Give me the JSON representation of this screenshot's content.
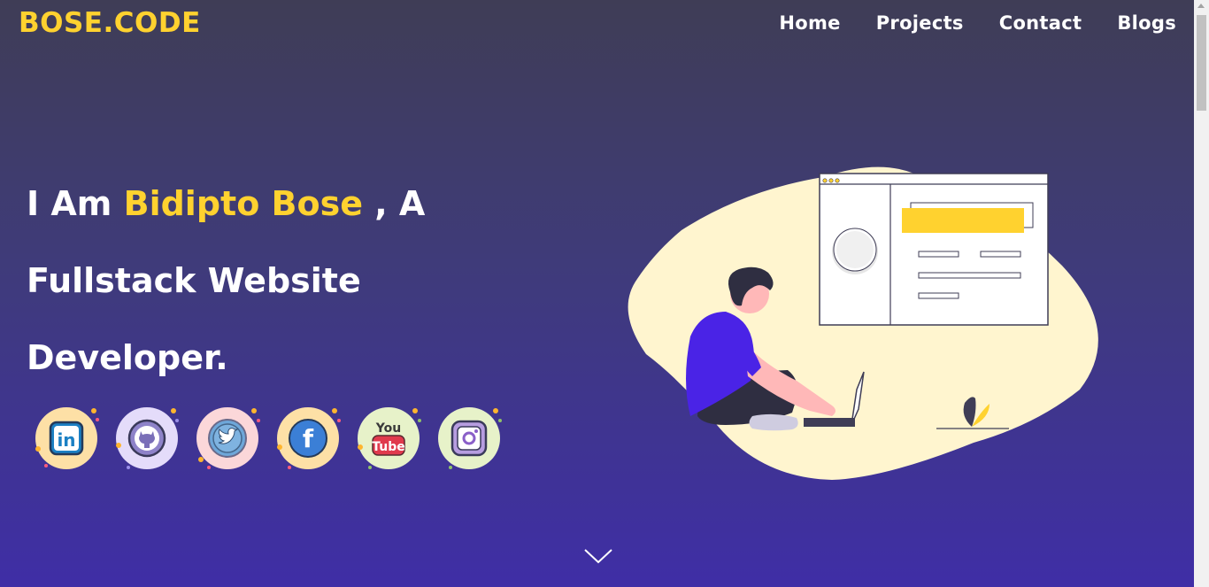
{
  "header": {
    "brand": "BOSE.CODE",
    "nav": [
      "Home",
      "Projects",
      "Contact",
      "Blogs"
    ]
  },
  "hero": {
    "line1_prefix": "I Am ",
    "line1_name": "Bidipto Bose",
    "line1_suffix": " , A",
    "line2": "Fullstack Website",
    "line3": "Developer."
  },
  "socials": [
    {
      "name": "linkedin",
      "label": "in"
    },
    {
      "name": "github",
      "label": ""
    },
    {
      "name": "twitter",
      "label": ""
    },
    {
      "name": "facebook",
      "label": "f"
    },
    {
      "name": "youtube",
      "label_top": "You",
      "label_bottom": "Tube"
    },
    {
      "name": "instagram",
      "label": ""
    }
  ],
  "colors": {
    "accent": "#ffd22f",
    "illustration_bg": "#fff5cf",
    "person_shirt": "#4a23e6"
  }
}
